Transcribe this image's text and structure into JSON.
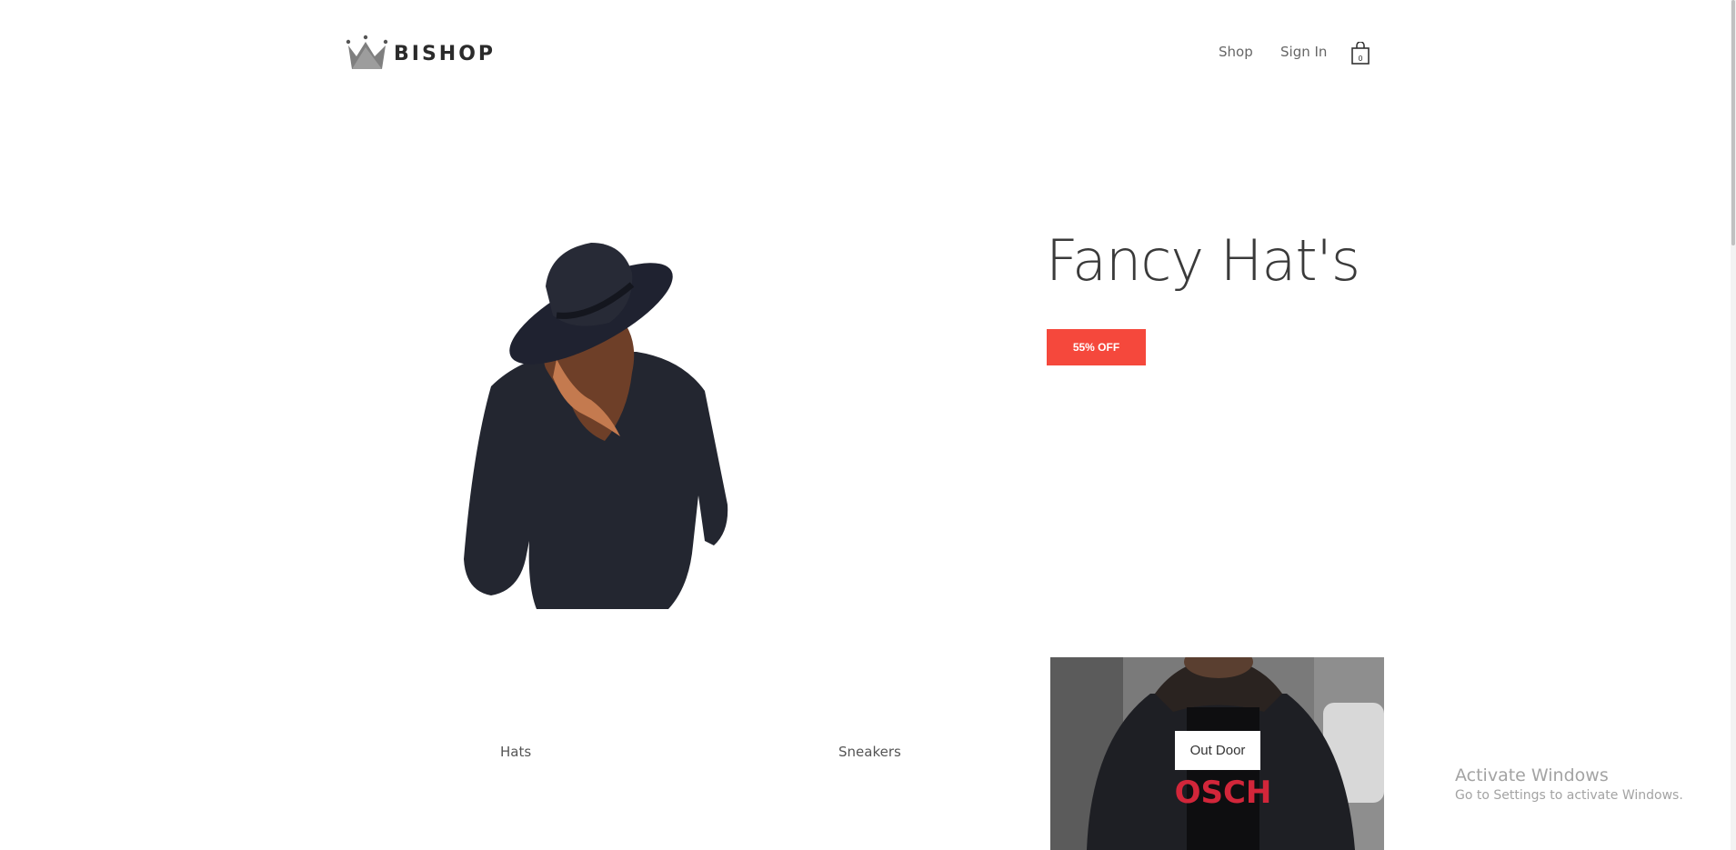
{
  "header": {
    "logo_text": "BISHOP",
    "nav": {
      "shop": "Shop",
      "sign_in": "Sign In"
    },
    "cart_count": "0"
  },
  "hero": {
    "title": "Fancy Hat's",
    "badge": "55% OFF",
    "accent_color": "#f5483c"
  },
  "categories": {
    "hats": "Hats",
    "sneakers": "Sneakers",
    "outdoor": "Out Door"
  },
  "watermark": {
    "title": "Activate Windows",
    "subtitle": "Go to Settings to activate Windows."
  },
  "icons": [
    "crown-icon",
    "shopping-bag-icon"
  ]
}
